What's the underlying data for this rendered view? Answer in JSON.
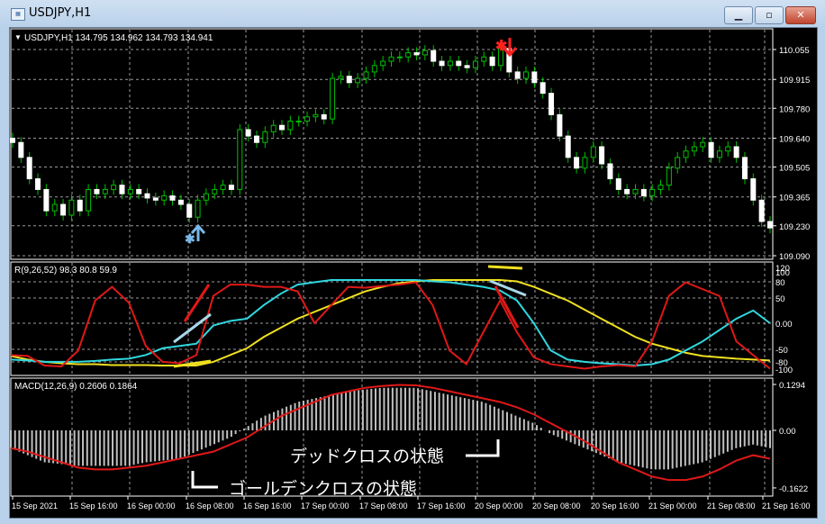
{
  "window": {
    "title": "USDJPY,H1",
    "buttons": [
      "minimize",
      "maximize",
      "close"
    ]
  },
  "main_pane": {
    "header": "USDJPY,H1  134.795 134.962 134.793 134.941",
    "price_labels": [
      "110.055",
      "109.915",
      "109.780",
      "109.640",
      "109.505",
      "109.365",
      "109.230",
      "109.090"
    ],
    "sell_signal_icon": "red-down-arrow-with-star",
    "buy_signal_icon": "blue-up-arrow-with-star",
    "colors": {
      "bull": "#00c000",
      "bear": "#ffffff",
      "wick": "#00c000"
    }
  },
  "rci_pane": {
    "header": "R(9,26,52) 98.3 80.8 59.9",
    "axis_labels": [
      "120",
      "100",
      "80",
      "50",
      "0.00",
      "-50",
      "-80",
      "-100"
    ],
    "colors": {
      "short": "#e01818",
      "mid": "#30d8e0",
      "long": "#f0e020"
    }
  },
  "macd_pane": {
    "header": "MACD(12,26,9) 0.2606 0.1864",
    "axis_labels": [
      "0.1294",
      "0.00",
      "-0.1622"
    ],
    "colors": {
      "histogram": "#c0c0c0",
      "signal": "#e01818"
    }
  },
  "time_axis": [
    "15 Sep 2021",
    "15 Sep 16:00",
    "16 Sep 00:00",
    "16 Sep 08:00",
    "16 Sep 16:00",
    "17 Sep 00:00",
    "17 Sep 08:00",
    "17 Sep 16:00",
    "20 Sep 00:00",
    "20 Sep 08:00",
    "20 Sep 16:00",
    "21 Sep 00:00",
    "21 Sep 08:00",
    "21 Sep 16:00"
  ],
  "annotations": {
    "dead_cross": "デッドクロスの状態",
    "golden_cross": "ゴールデンクロスの状態"
  },
  "chart_data": [
    {
      "type": "candlestick",
      "title": "USDJPY,H1",
      "ylim": [
        109.09,
        110.1
      ],
      "closes": [
        109.62,
        109.55,
        109.45,
        109.4,
        109.3,
        109.33,
        109.28,
        109.35,
        109.3,
        109.4,
        109.38,
        109.4,
        109.42,
        109.38,
        109.4,
        109.38,
        109.36,
        109.35,
        109.37,
        109.35,
        109.33,
        109.27,
        109.35,
        109.38,
        109.4,
        109.42,
        109.4,
        109.68,
        109.65,
        109.62,
        109.67,
        109.7,
        109.68,
        109.72,
        109.72,
        109.74,
        109.75,
        109.73,
        109.92,
        109.93,
        109.9,
        109.92,
        109.95,
        109.98,
        110.0,
        110.02,
        110.02,
        110.04,
        110.03,
        110.05,
        110.0,
        109.98,
        110.0,
        109.98,
        109.97,
        110.0,
        110.02,
        109.98,
        110.06,
        109.95,
        109.92,
        109.95,
        109.9,
        109.85,
        109.75,
        109.65,
        109.55,
        109.5,
        109.55,
        109.6,
        109.52,
        109.45,
        109.4,
        109.38,
        109.4,
        109.37,
        109.4,
        109.42,
        109.5,
        109.55,
        109.58,
        109.6,
        109.62,
        109.55,
        109.58,
        109.6,
        109.55,
        109.45,
        109.35,
        109.25,
        109.22
      ]
    },
    {
      "type": "line",
      "title": "R(9,26,52)",
      "ylim": [
        -100,
        120
      ],
      "series": [
        {
          "values": [
            -70,
            -72,
            -93,
            -95,
            -60,
            50,
            80,
            45,
            -50,
            -85,
            -88,
            -70,
            60,
            85,
            85,
            80,
            80,
            70,
            0,
            40,
            80,
            78,
            82,
            85,
            90,
            40,
            -60,
            -90,
            -20,
            50,
            -20,
            -75,
            -90,
            -95,
            -100,
            -95,
            -92,
            -95,
            -40,
            60,
            90,
            75,
            60,
            -40,
            -70,
            -100
          ]
        },
        {
          "values": [
            -80,
            -82,
            -85,
            -85,
            -85,
            -83,
            -80,
            -78,
            -70,
            -55,
            -50,
            -45,
            -5,
            5,
            10,
            40,
            65,
            85,
            90,
            95,
            95,
            95,
            95,
            95,
            95,
            92,
            90,
            85,
            80,
            72,
            50,
            0,
            -60,
            -80,
            -85,
            -88,
            -90,
            -93,
            -90,
            -80,
            -60,
            -40,
            -15,
            10,
            28,
            0
          ]
        },
        {
          "values": [
            -72,
            -80,
            -85,
            -88,
            -90,
            -90,
            -92,
            -92,
            -92,
            -93,
            -93,
            -93,
            -85,
            -70,
            -55,
            -30,
            -10,
            10,
            25,
            40,
            55,
            70,
            80,
            88,
            92,
            95,
            95,
            95,
            95,
            95,
            92,
            80,
            65,
            50,
            30,
            10,
            -10,
            -30,
            -45,
            -55,
            -65,
            -72,
            -75,
            -78,
            -80,
            -82
          ]
        }
      ]
    },
    {
      "type": "bar+line",
      "title": "MACD(12,26,9)",
      "ylim": [
        -0.1622,
        0.1294
      ],
      "histogram": [
        -0.05,
        -0.07,
        -0.09,
        -0.095,
        -0.1,
        -0.1,
        -0.1,
        -0.1,
        -0.09,
        -0.085,
        -0.08,
        -0.06,
        -0.04,
        -0.02,
        0.01,
        0.04,
        0.06,
        0.08,
        0.09,
        0.1,
        0.11,
        0.115,
        0.12,
        0.12,
        0.12,
        0.11,
        0.1,
        0.09,
        0.08,
        0.06,
        0.04,
        0.02,
        -0.01,
        -0.03,
        -0.05,
        -0.07,
        -0.09,
        -0.1,
        -0.11,
        -0.11,
        -0.1,
        -0.09,
        -0.07,
        -0.05,
        -0.04,
        -0.05
      ],
      "signal": [
        -0.05,
        -0.06,
        -0.075,
        -0.09,
        -0.105,
        -0.11,
        -0.11,
        -0.105,
        -0.1,
        -0.09,
        -0.08,
        -0.07,
        -0.06,
        -0.04,
        -0.02,
        0.01,
        0.04,
        0.06,
        0.08,
        0.1,
        0.11,
        0.12,
        0.125,
        0.128,
        0.127,
        0.12,
        0.11,
        0.1,
        0.09,
        0.08,
        0.065,
        0.045,
        0.02,
        -0.005,
        -0.03,
        -0.06,
        -0.09,
        -0.11,
        -0.13,
        -0.14,
        -0.14,
        -0.13,
        -0.11,
        -0.085,
        -0.07,
        -0.08
      ]
    }
  ]
}
